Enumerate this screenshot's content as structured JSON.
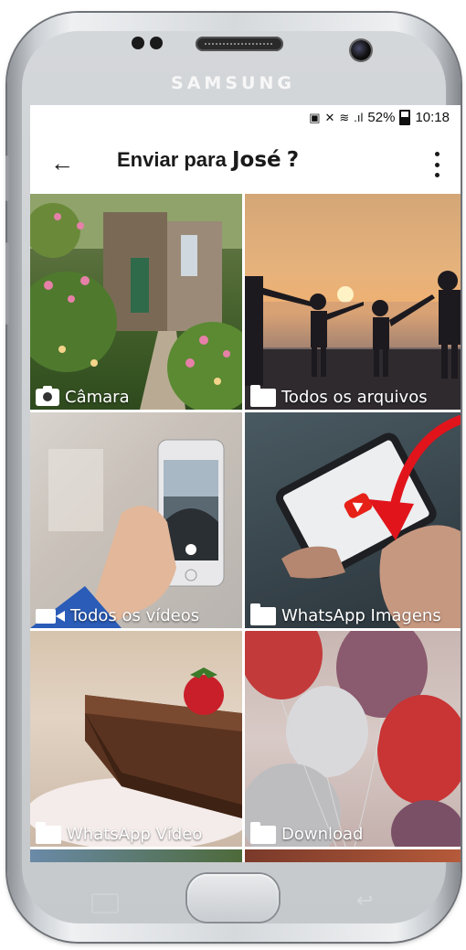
{
  "device": {
    "brand": "SAMSUNG"
  },
  "status_bar": {
    "signal_text": "52%",
    "time": "10:18"
  },
  "app_bar": {
    "back_icon": "arrow-left-icon",
    "title_prefix": "Enviar para",
    "title_name": "José",
    "title_suffix": "?",
    "more_icon": "more-vertical-icon"
  },
  "tiles": [
    {
      "label": "Câmara",
      "icon": "camera-icon"
    },
    {
      "label": "Todos os arquivos",
      "icon": "folder-icon"
    },
    {
      "label": "Todos os vídeos",
      "icon": "video-icon"
    },
    {
      "label": "WhatsApp Imagens",
      "icon": "folder-icon"
    },
    {
      "label": "WhatsApp Vídeo",
      "icon": "folder-icon"
    },
    {
      "label": "Download",
      "icon": "folder-icon"
    }
  ],
  "colors": {
    "annotation_arrow": "#e1141c",
    "youtube_red": "#e62117"
  }
}
